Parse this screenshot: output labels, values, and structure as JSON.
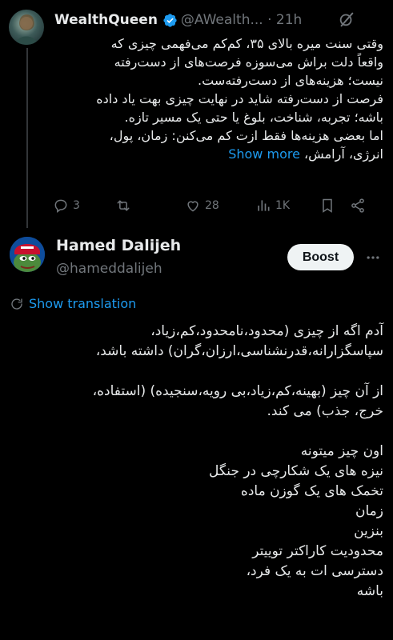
{
  "tweet": {
    "author_name": "WealthQueen",
    "author_handle": "@AWealth...",
    "time": "21h",
    "text_lines": [
      "وقتی سنت میره بالای ۳۵، کم‌کم می‌فهمی چیزی که",
      "واقعاً دلت براش می‌سوزه فرصت‌های از دست‌رفته",
      "نیست؛ هزینه‌های از دست‌رفته‌ست.",
      "فرصت از دست‌رفته شاید در نهایت چیزی بهت یاد داده",
      "باشه؛ تجربه، شناخت، بلوغ یا حتی یک مسیر تازه.",
      "اما بعضی هزینه‌ها فقط ازت کم می‌کنن:  زمان، پول،",
      "انرژی، آرامش،"
    ],
    "show_more": "Show more",
    "counts": {
      "replies": "3",
      "retweets": "",
      "likes": "28",
      "views": "1K"
    },
    "accent": "#1d9bf0"
  },
  "reply": {
    "author_name": "Hamed Dalijeh",
    "author_handle": "@hameddalijeh",
    "boost_label": "Boost",
    "translation_label": "Show translation",
    "text_lines": [
      "آدم اگه از چیزی (محدود،نامحدود،کم،زیاد،",
      "سپاسگزارانه،قدرنشناسی،ارزان،گران) داشته باشد،",
      "",
      " از آن چیز (بهینه،کم،زیاد،بی رویه،سنجیده) (استفاده،",
      "خرج، جذب) می کند.",
      "",
      "اون چیز میتونه",
      "نیزه های یک شکارچی در جنگل",
      "تخمک های یک گوزن ماده",
      "زمان",
      "بنزین",
      "محدودیت کاراکتر توییتر",
      "دسترسی ات به یک فرد،",
      "باشه"
    ]
  }
}
